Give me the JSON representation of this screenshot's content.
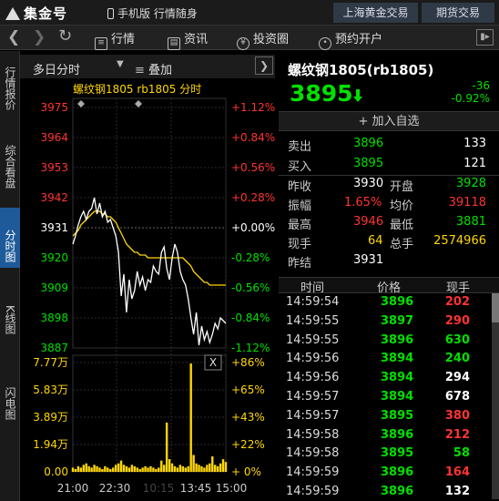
{
  "titlebar": {
    "logo": "集金号",
    "mobile": "手机版 行情随身",
    "tab_sgex": "上海黄金交易",
    "tab_futures": "期货交易"
  },
  "toolbar": {
    "quotes": "行情",
    "news": "资讯",
    "advisor": "投资圈",
    "open_account": "预约开户"
  },
  "sidetabs": [
    "行情报价",
    "综合看盘",
    "分时图",
    "K线图",
    "闪电图"
  ],
  "chart": {
    "period": "多日分时",
    "overlay": "叠加",
    "legend": "螺纹钢1805 rb1805 分时",
    "price_labels": [
      "3975",
      "3964",
      "3953",
      "3942",
      "3931",
      "3920",
      "3909",
      "3898",
      "3887"
    ],
    "pct_labels": [
      "+1.12%",
      "+0.84%",
      "+0.56%",
      "+0.28%",
      "+0.00%",
      "-0.28%",
      "-0.56%",
      "-0.84%",
      "-1.12%"
    ],
    "vol_labels": [
      "7.77万",
      "5.83万",
      "3.89万",
      "1.94万",
      "0.00"
    ],
    "vol_pct_labels": [
      "+86%",
      "+65%",
      "+43%",
      "+22%",
      "+ 0%"
    ],
    "time_labels": [
      "21:00",
      "22:30",
      "13:45",
      "15:00"
    ],
    "middle_time": "10:15",
    "close_btn": "X",
    "colors": {
      "price_line": "#ffffff",
      "avg_line": "#ffd700",
      "volume": "#ffd700",
      "up": "#ff3333",
      "down": "#00e000"
    }
  },
  "chart_data": {
    "type": "line",
    "title": "螺纹钢1805 rb1805 分时",
    "ylim": [
      3887,
      3975
    ],
    "prev_close": 3931,
    "x": [
      0,
      4,
      8,
      12,
      16,
      20,
      24,
      28,
      32,
      36,
      40,
      44,
      48,
      52,
      56,
      60,
      64,
      68,
      72,
      76,
      80,
      84,
      88,
      92,
      96,
      100,
      104,
      108,
      112,
      116,
      120,
      124,
      128,
      132,
      136,
      140,
      144,
      148,
      152,
      156,
      160,
      164,
      168,
      172,
      176,
      180,
      184,
      188,
      192,
      196,
      200,
      204,
      208,
      212,
      216,
      220,
      224,
      228
    ],
    "series": [
      {
        "values": [
          3925,
          3928,
          3932,
          3935,
          3937,
          3934,
          3937,
          3938,
          3942,
          3936,
          3940,
          3935,
          3937,
          3933,
          3934,
          3931,
          3928,
          3922,
          3906,
          3914,
          3900,
          3912,
          3905,
          3908,
          3915,
          3910,
          3913,
          3908,
          3912,
          3911,
          3917,
          3915,
          3914,
          3922,
          3924,
          3916,
          3912,
          3920,
          3925,
          3922,
          3915,
          3912,
          3910,
          3905,
          3898,
          3892,
          3900,
          3888,
          3895,
          3890,
          3893,
          3889,
          3892,
          3896,
          3894,
          3898,
          3897,
          3896
        ]
      },
      {
        "values": [
          3928,
          3929,
          3930,
          3932,
          3933,
          3934,
          3935,
          3936,
          3937,
          3937,
          3937,
          3936,
          3936,
          3935,
          3935,
          3934,
          3933,
          3931,
          3929,
          3927,
          3925,
          3924,
          3923,
          3922,
          3922,
          3921,
          3921,
          3921,
          3920,
          3920,
          3920,
          3920,
          3920,
          3920,
          3920,
          3920,
          3920,
          3920,
          3920,
          3920,
          3920,
          3920,
          3919,
          3918,
          3917,
          3915,
          3914,
          3913,
          3912,
          3911,
          3911,
          3910,
          3910,
          3910,
          3910,
          3910,
          3910,
          3910
        ]
      }
    ],
    "volume": [
      0.3,
      0.2,
      0.4,
      0.3,
      0.5,
      0.6,
      0.4,
      0.3,
      0.5,
      0.4,
      0.3,
      0.2,
      0.4,
      0.3,
      0.2,
      0.3,
      0.5,
      0.6,
      0.8,
      0.5,
      0.4,
      0.3,
      0.5,
      0.4,
      0.3,
      0.2,
      0.3,
      0.4,
      0.3,
      0.4,
      0.3,
      0.2,
      0.3,
      0.8,
      0.5,
      3.5,
      0.9,
      0.6,
      0.4,
      0.3,
      0.5,
      0.4,
      0.3,
      0.4,
      7.7,
      1.2,
      0.6,
      0.5,
      0.4,
      0.3,
      0.5,
      0.6,
      1.1,
      0.5,
      0.4,
      0.6,
      0.9,
      0.7
    ]
  },
  "quote": {
    "name": "螺纹钢1805(rb1805)",
    "price": "3895",
    "change": "-36",
    "change_pct": "-0.92%",
    "add_fav": "+ 加入自选",
    "sell_label": "卖出",
    "sell_price": "3896",
    "sell_vol": "133",
    "buy_label": "买入",
    "buy_price": "3895",
    "buy_vol": "121",
    "prev_close_label": "昨收",
    "prev_close": "3930",
    "open_label": "开盘",
    "open": "3928",
    "amplitude_label": "振幅",
    "amplitude": "1.65%",
    "avg_label": "均价",
    "avg": "39118",
    "high_label": "最高",
    "high": "3946",
    "low_label": "最低",
    "low": "3881",
    "cur_vol_label": "现手",
    "cur_vol": "64",
    "total_vol_label": "总手",
    "total_vol": "2574966",
    "settle_label": "昨结",
    "settle": "3931"
  },
  "ticks": {
    "head_time": "时间",
    "head_price": "价格",
    "head_vol": "现手",
    "rows": [
      {
        "time": "14:59:54",
        "price": "3896",
        "vol": "202",
        "dir": "r"
      },
      {
        "time": "14:59:55",
        "price": "3897",
        "vol": "290",
        "dir": "r"
      },
      {
        "time": "14:59:55",
        "price": "3896",
        "vol": "630",
        "dir": "g"
      },
      {
        "time": "14:59:56",
        "price": "3894",
        "vol": "240",
        "dir": "g"
      },
      {
        "time": "14:59:56",
        "price": "3894",
        "vol": "294",
        "dir": "w"
      },
      {
        "time": "14:59:57",
        "price": "3894",
        "vol": "678",
        "dir": "w"
      },
      {
        "time": "14:59:57",
        "price": "3895",
        "vol": "380",
        "dir": "r"
      },
      {
        "time": "14:59:58",
        "price": "3896",
        "vol": "212",
        "dir": "r"
      },
      {
        "time": "14:59:58",
        "price": "3895",
        "vol": "58",
        "dir": "g"
      },
      {
        "time": "14:59:59",
        "price": "3896",
        "vol": "164",
        "dir": "r"
      },
      {
        "time": "14:59:59",
        "price": "3896",
        "vol": "132",
        "dir": "w"
      }
    ]
  }
}
